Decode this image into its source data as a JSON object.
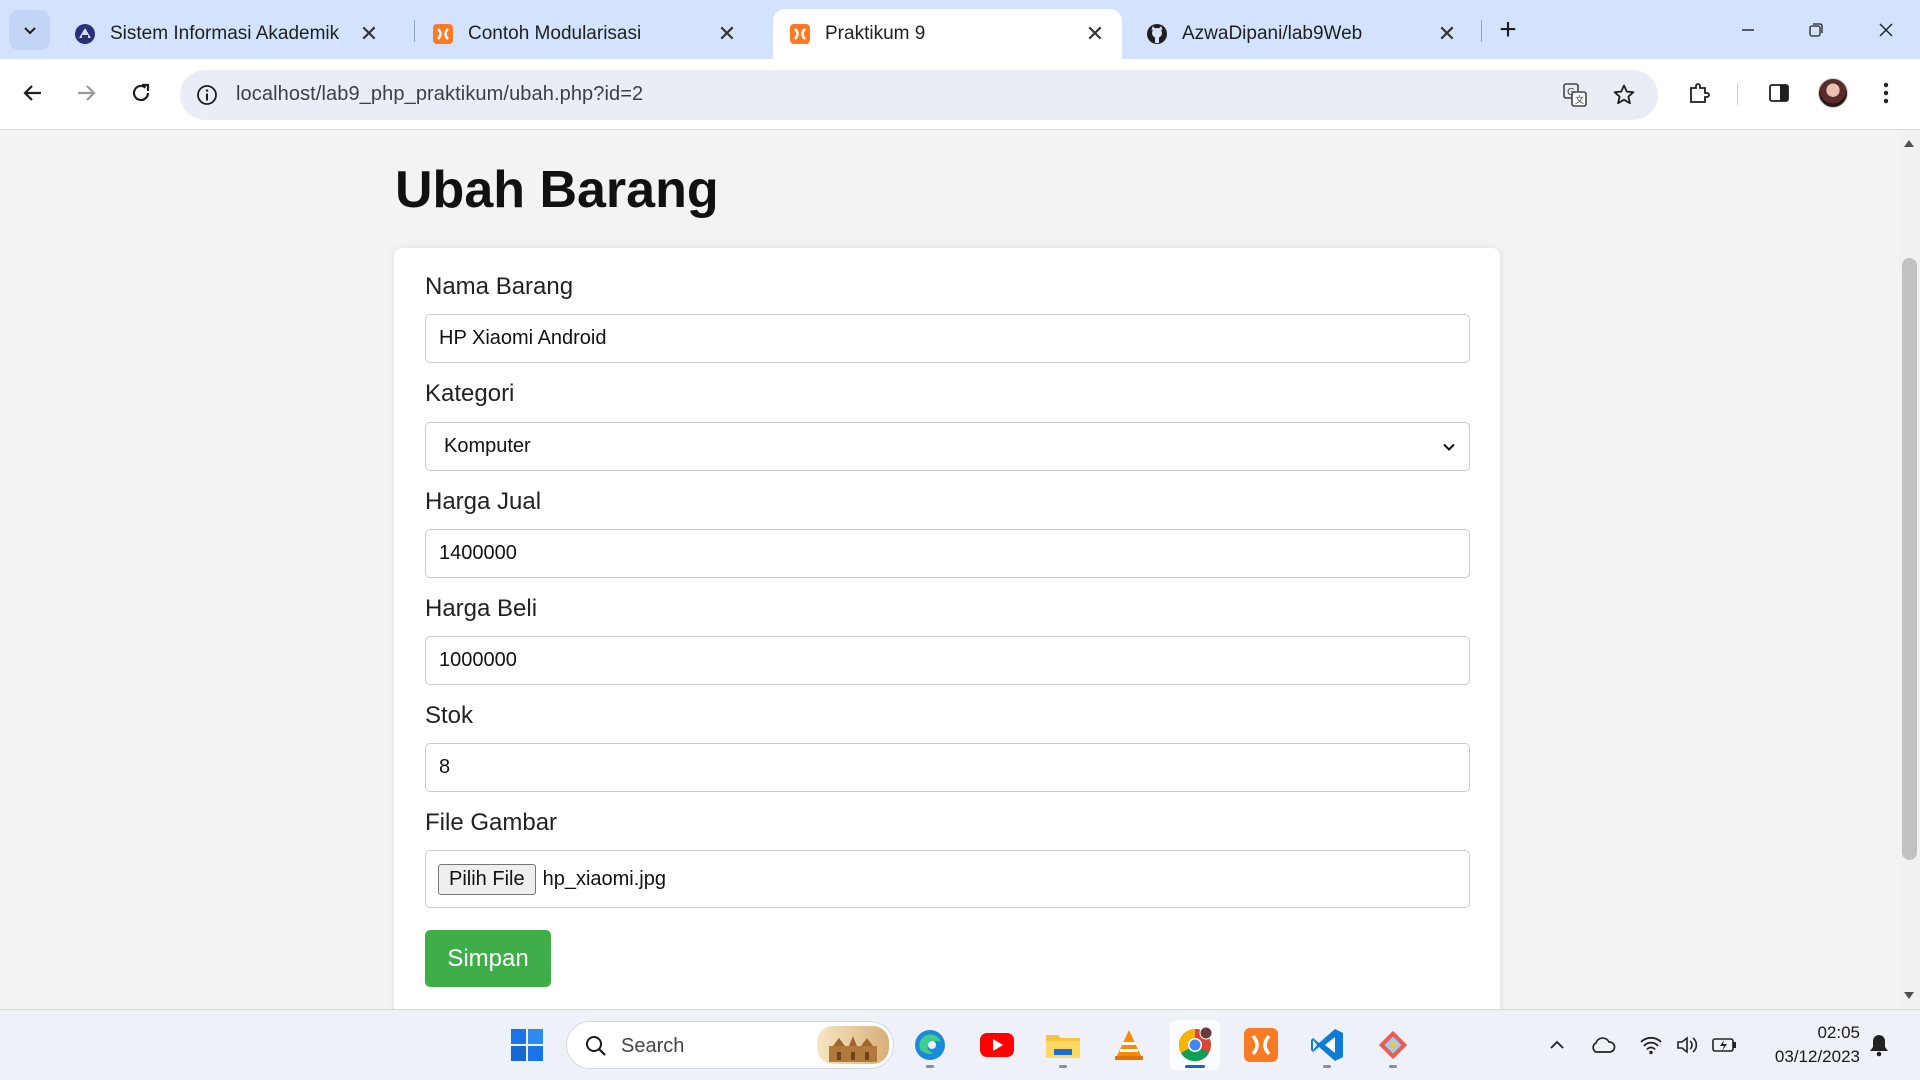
{
  "browser": {
    "tabs": [
      {
        "title": "Sistem Informasi Akademik",
        "favicon": "university-icon",
        "active": false
      },
      {
        "title": "Contoh Modularisasi",
        "favicon": "xampp-icon",
        "active": false
      },
      {
        "title": "Praktikum 9",
        "favicon": "xampp-icon",
        "active": true
      },
      {
        "title": "AzwaDipani/lab9Web",
        "favicon": "github-icon",
        "active": false
      }
    ],
    "url": "localhost/lab9_php_praktikum/ubah.php?id=2"
  },
  "page": {
    "title": "Ubah Barang",
    "form": {
      "nama_label": "Nama Barang",
      "nama_value": "HP Xiaomi Android",
      "kategori_label": "Kategori",
      "kategori_value": "Komputer",
      "harga_jual_label": "Harga Jual",
      "harga_jual_value": "1400000",
      "harga_beli_label": "Harga Beli",
      "harga_beli_value": "1000000",
      "stok_label": "Stok",
      "stok_value": "8",
      "gambar_label": "File Gambar",
      "file_button": "Pilih File",
      "file_name": "hp_xiaomi.jpg",
      "submit_label": "Simpan"
    }
  },
  "taskbar": {
    "search_placeholder": "Search",
    "apps": [
      "edge-icon",
      "youtube-icon",
      "file-explorer-icon",
      "vlc-icon",
      "chrome-icon",
      "xampp-icon",
      "vscode-icon",
      "git-icon"
    ],
    "time": "02:05",
    "date": "03/12/2023"
  },
  "colors": {
    "submit": "#3fae49",
    "tabstrip": "#d3e3fd"
  }
}
